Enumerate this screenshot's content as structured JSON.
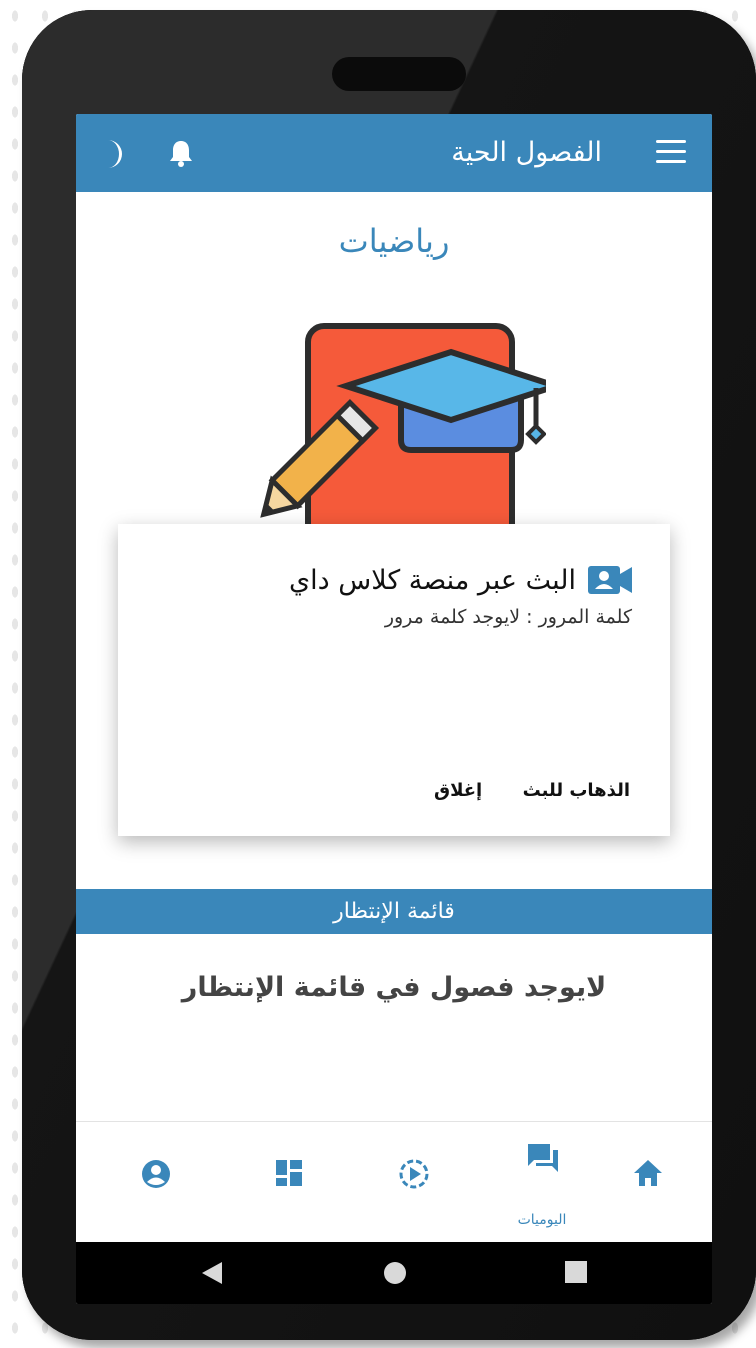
{
  "app_bar": {
    "title": "الفصول الحية",
    "menu_icon": "hamburger-menu-icon",
    "notifications_icon": "bell-icon",
    "theme_icon": "moon-icon",
    "color": "#3a87ba"
  },
  "subject": {
    "title": "رياضيات",
    "illustration": "book-pencil-graduation-cap-icon"
  },
  "dialog": {
    "heading": "البث عبر منصة كلاس داي",
    "heading_icon": "video-contact-icon",
    "password_line": "كلمة المرور : لايوجد كلمة مرور",
    "go_button": "الذهاب للبث",
    "close_button": "إغلاق"
  },
  "waiting": {
    "header": "قائمة الإنتظار",
    "empty_message": "لايوجد فصول في قائمة الإنتظار"
  },
  "bottom_nav": {
    "items": [
      {
        "icon": "home-icon",
        "label": ""
      },
      {
        "icon": "forum-chat-icon",
        "label": "اليوميات"
      },
      {
        "icon": "play-circle-icon",
        "label": ""
      },
      {
        "icon": "dashboard-icon",
        "label": ""
      },
      {
        "icon": "account-circle-icon",
        "label": ""
      }
    ]
  },
  "system_nav": [
    "back-icon",
    "home-circle-icon",
    "recents-square-icon"
  ]
}
